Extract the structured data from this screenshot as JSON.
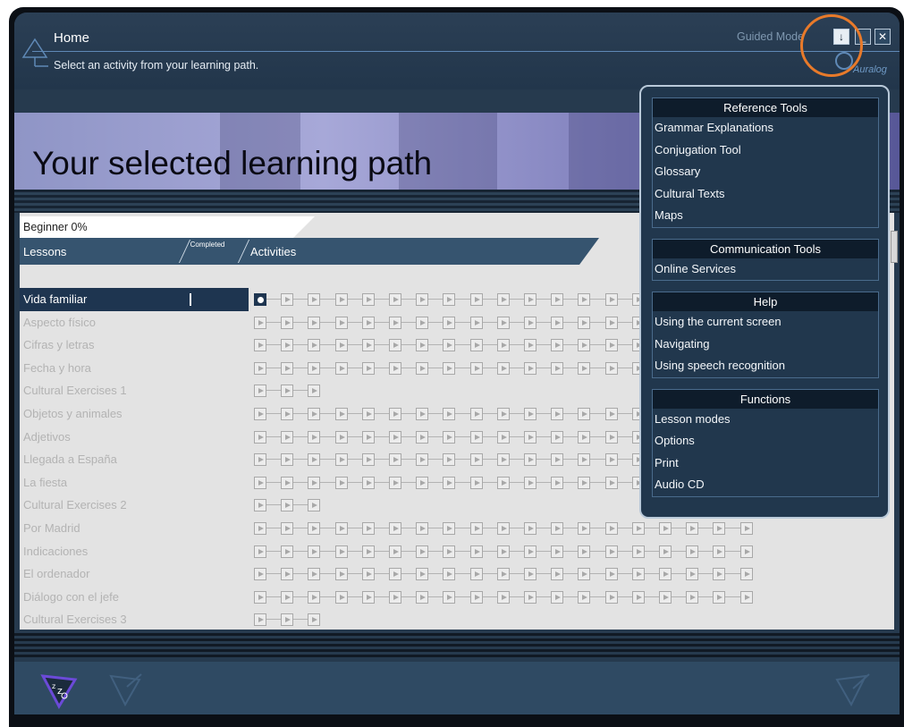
{
  "header": {
    "title": "Home",
    "instruction": "Select an activity from your learning path.",
    "mode_label": "Guided Mode",
    "logo_text": "Auralog",
    "buttons": {
      "menu": "↓",
      "minimize": "_",
      "close": "✕"
    }
  },
  "banner": {
    "title": "Your selected learning path"
  },
  "panel": {
    "level_label": "Beginner 0%",
    "columns": {
      "lessons": "Lessons",
      "completed": "Completed",
      "activities": "Activities"
    }
  },
  "lessons": [
    {
      "name": "Vida familiar",
      "activities": 15,
      "active": true
    },
    {
      "name": "Aspecto físico",
      "activities": 15
    },
    {
      "name": "Cifras y letras",
      "activities": 15
    },
    {
      "name": "Fecha y hora",
      "activities": 15
    },
    {
      "name": "Cultural Exercises 1",
      "activities": 3
    },
    {
      "name": "Objetos y animales",
      "activities": 15
    },
    {
      "name": "Adjetivos",
      "activities": 15
    },
    {
      "name": "Llegada a España",
      "activities": 15
    },
    {
      "name": "La fiesta",
      "activities": 15
    },
    {
      "name": "Cultural Exercises 2",
      "activities": 3
    },
    {
      "name": "Por Madrid",
      "activities": 19
    },
    {
      "name": "Indicaciones",
      "activities": 19
    },
    {
      "name": "El ordenador",
      "activities": 19
    },
    {
      "name": "Diálogo con el jefe",
      "activities": 19
    },
    {
      "name": "Cultural Exercises 3",
      "activities": 3
    }
  ],
  "menu": {
    "sections": [
      {
        "title": "Reference Tools",
        "items": [
          "Grammar Explanations",
          "Conjugation Tool",
          "Glossary",
          "Cultural Texts",
          "Maps"
        ]
      },
      {
        "title": "Communication Tools",
        "items": [
          "Online Services"
        ]
      },
      {
        "title": "Help",
        "items": [
          "Using the current screen",
          "Navigating",
          "Using speech recognition"
        ]
      },
      {
        "title": "Functions",
        "items": [
          "Lesson modes",
          "Options",
          "Print",
          "Audio CD"
        ]
      }
    ]
  },
  "colors": {
    "accent_ring": "#e87a2a",
    "active_row": "#1e3550",
    "panel_bg": "#e3e3e3",
    "menu_bg": "#21374d"
  }
}
